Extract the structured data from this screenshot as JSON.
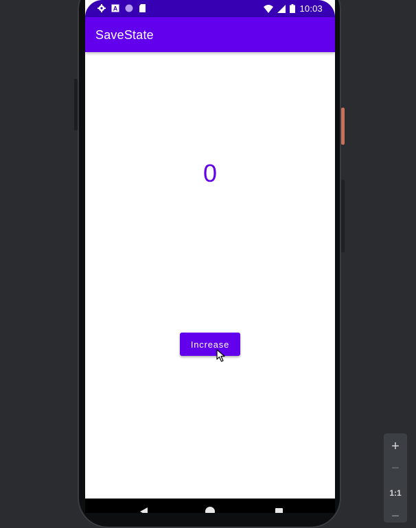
{
  "status_bar": {
    "time": "10:03",
    "left_icons": [
      "gear-icon",
      "a-box-icon",
      "circle-icon",
      "sd-card-icon"
    ],
    "right_icons": [
      "wifi-icon",
      "signal-icon",
      "battery-icon"
    ]
  },
  "app_bar": {
    "title": "SaveState"
  },
  "main": {
    "counter_value": "0",
    "increase_label": "Increase"
  },
  "nav_bar": {
    "icons": [
      "back-icon",
      "home-icon",
      "recents-icon"
    ]
  },
  "zoom_toolbar": {
    "zoom_in": "+",
    "zoom_out": "−",
    "actual_size": "1:1",
    "fit": "−"
  },
  "colors": {
    "primary": "#6200ee",
    "primary_dark": "#3700b3",
    "background": "#ffffff",
    "emulator_bg": "#2b2c2f"
  }
}
